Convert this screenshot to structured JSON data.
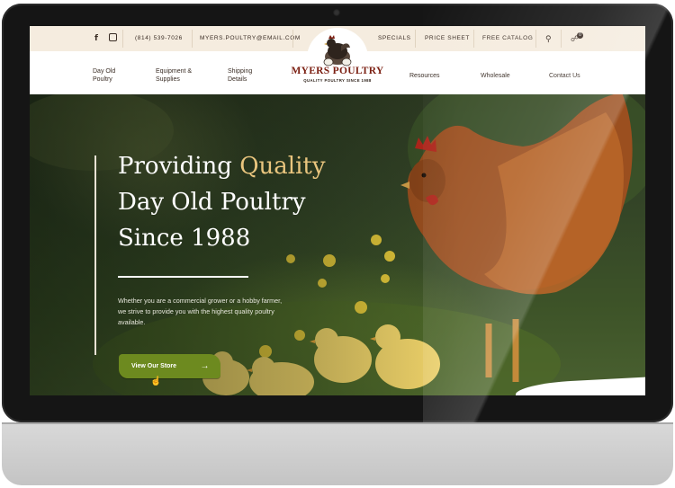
{
  "topbar": {
    "phone": "(814) 539-7026",
    "email": "MYERS.POULTRY@EMAIL.COM",
    "links": [
      "SPECIALS",
      "PRICE SHEET",
      "FREE CATALOG"
    ],
    "cart_count": "0",
    "social_icons": [
      "facebook-icon",
      "instagram-icon"
    ]
  },
  "nav": {
    "left": [
      "Day Old Poultry",
      "Equipment & Supplies",
      "Shipping Details"
    ],
    "right": [
      "Resources",
      "Wholesale",
      "Contact Us"
    ]
  },
  "logo": {
    "name": "MYERS POULTRY",
    "tagline": "QUALITY POULTRY SINCE 1988"
  },
  "hero": {
    "headline_part1": "Providing",
    "headline_highlight": "Quality",
    "headline_line2": "Day Old Poultry",
    "headline_line3": "Since 1988",
    "paragraph": "Whether you are a commercial grower or a hobby farmer, we strive to provide you with the highest quality poultry available.",
    "cta_label": "View Our Store"
  },
  "colors": {
    "accent_green": "#6d8a1f",
    "gold": "#e9c57e",
    "brand_red": "#7b1f12",
    "topbar_bg": "#f5ecdf"
  }
}
